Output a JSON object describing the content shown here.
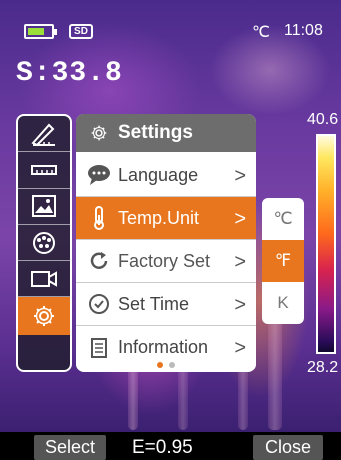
{
  "status": {
    "sd_label": "SD",
    "temp_unit": "℃",
    "time": "11:08"
  },
  "measurement": {
    "spot": "S:33.8"
  },
  "toolbar": {
    "items": [
      {
        "name": "measure-tool-icon",
        "active": false
      },
      {
        "name": "ruler-icon",
        "active": false
      },
      {
        "name": "image-icon",
        "active": false
      },
      {
        "name": "palette-icon",
        "active": false
      },
      {
        "name": "video-icon",
        "active": false
      },
      {
        "name": "settings-gear-icon",
        "active": true
      }
    ]
  },
  "settings": {
    "title": "Settings",
    "items": [
      {
        "label": "Language",
        "icon": "speech-bubble-icon",
        "chevron": ">"
      },
      {
        "label": "Temp.Unit",
        "icon": "thermometer-icon",
        "chevron": ">"
      },
      {
        "label": "Factory Set",
        "icon": "reset-icon",
        "chevron": ">"
      },
      {
        "label": "Set Time",
        "icon": "clock-icon",
        "chevron": ">"
      },
      {
        "label": "Information",
        "icon": "document-icon",
        "chevron": ">"
      }
    ],
    "selected_index": 1
  },
  "unit_options": [
    "℃",
    "℉",
    "K"
  ],
  "unit_selected_index": 1,
  "scale": {
    "max": "40.6",
    "min": "28.2"
  },
  "bottom": {
    "select_label": "Select",
    "emissivity": "E=0.95",
    "close_label": "Close"
  },
  "colors": {
    "accent": "#e8761e",
    "header": "#6d6d6d"
  }
}
